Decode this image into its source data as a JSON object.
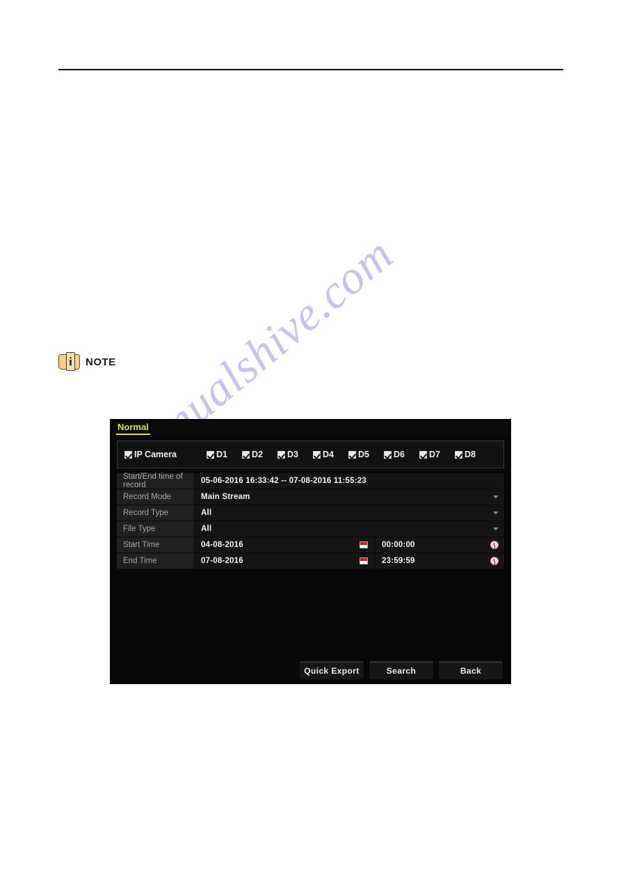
{
  "page": {
    "note_label": "NOTE",
    "note_icon": "book-info-icon",
    "watermark": "manualshive.com"
  },
  "dialog": {
    "tab": "Normal",
    "channels": [
      {
        "label": "IP Camera",
        "checked": true
      },
      {
        "label": "D1",
        "checked": true
      },
      {
        "label": "D2",
        "checked": true
      },
      {
        "label": "D3",
        "checked": true
      },
      {
        "label": "D4",
        "checked": true
      },
      {
        "label": "D5",
        "checked": true
      },
      {
        "label": "D6",
        "checked": true
      },
      {
        "label": "D7",
        "checked": true
      },
      {
        "label": "D8",
        "checked": true
      }
    ],
    "fields": {
      "record_range_label": "Start/End time of record",
      "record_range_value": "05-06-2016 16:33:42 -- 07-08-2016 11:55:23",
      "record_mode_label": "Record Mode",
      "record_mode_value": "Main Stream",
      "record_type_label": "Record Type",
      "record_type_value": "All",
      "file_type_label": "File Type",
      "file_type_value": "All",
      "start_time_label": "Start Time",
      "start_date_value": "04-08-2016",
      "start_clock_value": "00:00:00",
      "end_time_label": "End Time",
      "end_date_value": "07-08-2016",
      "end_clock_value": "23:59:59"
    },
    "buttons": {
      "quick_export": "Quick Export",
      "search": "Search",
      "back": "Back"
    },
    "colors": {
      "tab_accent": "#e3e24b",
      "panel_bg": "#080808",
      "value_text": "#f2f2f2",
      "label_text": "#a9a9a9",
      "calendar_accent": "#c62128"
    }
  }
}
